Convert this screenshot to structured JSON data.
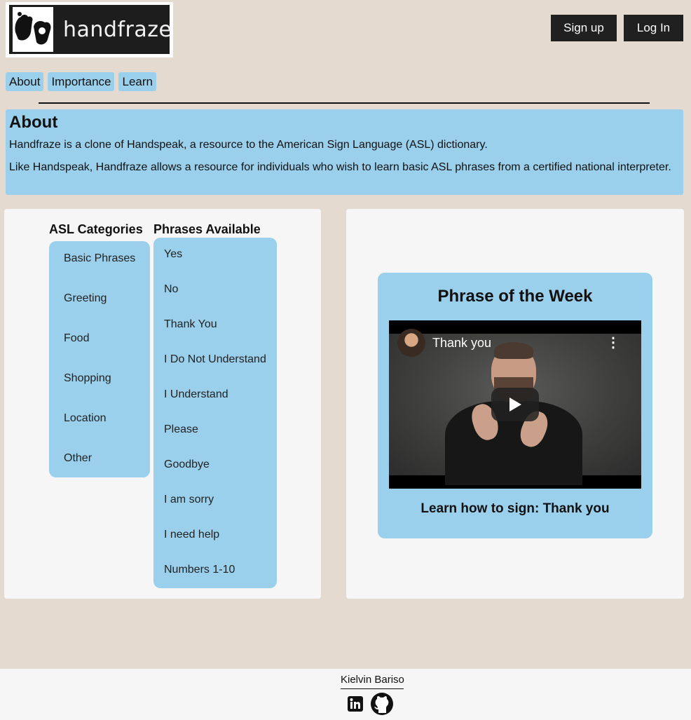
{
  "header": {
    "logo_text": "handfraze",
    "signup_label": "Sign up",
    "login_label": "Log In"
  },
  "nav": {
    "items": [
      {
        "label": "About"
      },
      {
        "label": "Importance"
      },
      {
        "label": "Learn"
      }
    ]
  },
  "about": {
    "title": "About",
    "paragraph1": "Handfraze is a clone of Handspeak, a resource to the American Sign Language (ASL) dictionary.",
    "paragraph2": "Like Handspeak, Handfraze allows a resource for individuals who wish to learn basic ASL phrases from a certified national interpreter."
  },
  "categories": {
    "title": "ASL Categories",
    "items": [
      "Basic Phrases",
      "Greeting",
      "Food",
      "Shopping",
      "Location",
      "Other"
    ]
  },
  "phrases": {
    "title": "Phrases Available",
    "items": [
      "Yes",
      "No",
      "Thank You",
      "I Do Not Understand",
      "I Understand",
      "Please",
      "Goodbye",
      "I am sorry",
      "I need help",
      "Numbers 1-10"
    ]
  },
  "phrase_of_week": {
    "title": "Phrase of the Week",
    "video_title": "Thank you",
    "caption": "Learn how to sign: Thank you"
  },
  "footer": {
    "author": "Kielvin Bariso",
    "icons": [
      "linkedin-icon",
      "github-icon"
    ]
  },
  "colors": {
    "background": "#e4dad0",
    "accent_blue": "#9ad0ec",
    "button_dark": "#202020",
    "panel": "#f6f6f6"
  }
}
